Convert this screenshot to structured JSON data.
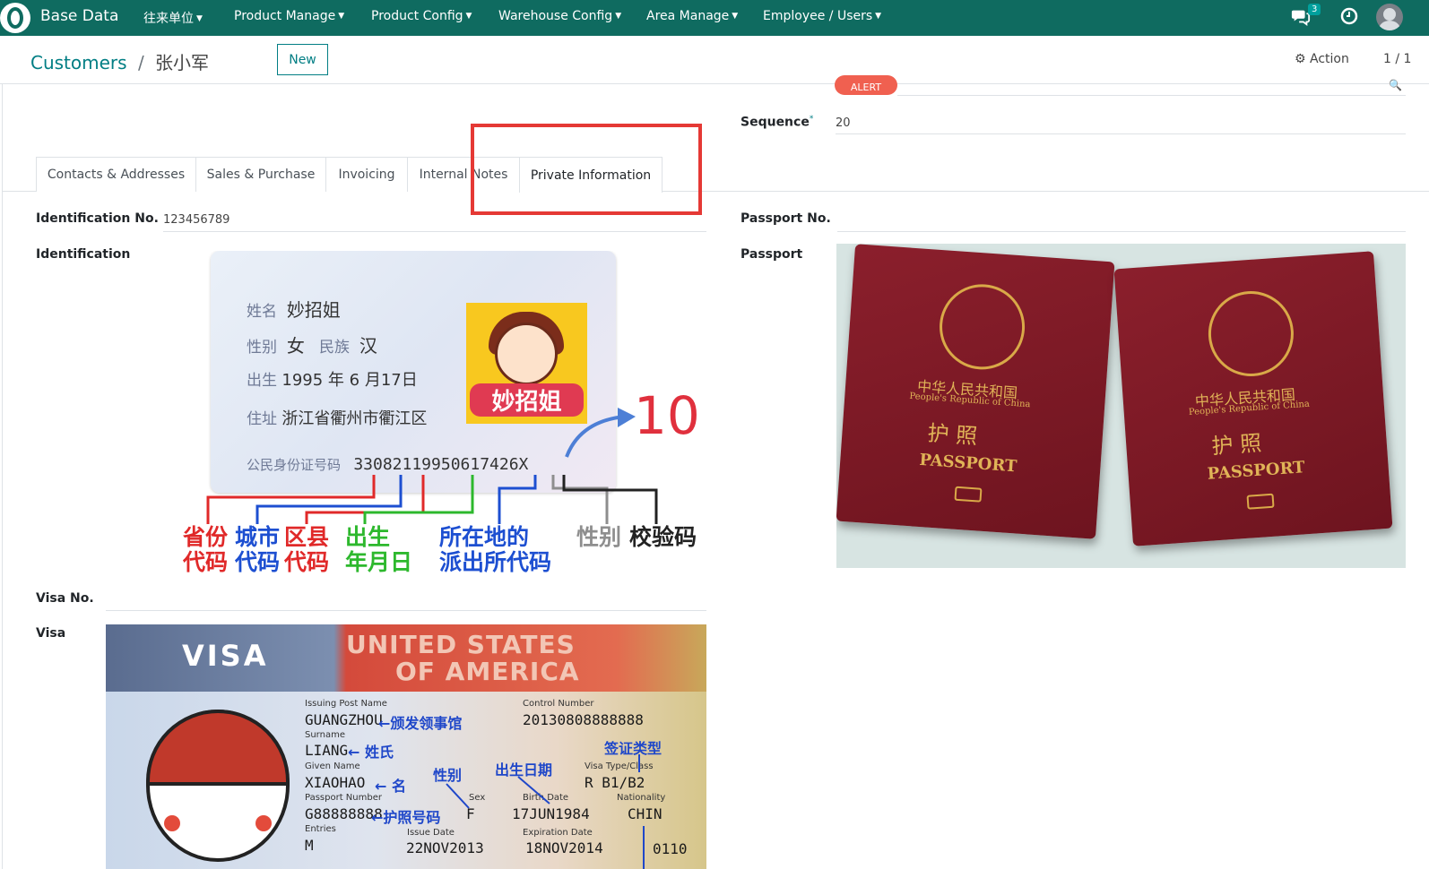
{
  "navbar": {
    "app_name": "Base Data",
    "menus": [
      "往来单位",
      "Product Manage",
      "Product Config",
      "Warehouse Config",
      "Area Manage",
      "Employee / Users"
    ],
    "chat_badge": "3",
    "icons": [
      "chat-icon",
      "clock-icon",
      "avatar"
    ]
  },
  "control": {
    "breadcrumb_parent": "Customers",
    "breadcrumb_sep": "/",
    "breadcrumb_current": "张小军",
    "new_label": "New",
    "action_label": "Action",
    "pager": "1 / 1"
  },
  "form": {
    "tag_label": "ALERT",
    "sequence_label": "Sequence",
    "sequence_required": "*",
    "sequence_value": "20",
    "tabs": [
      "Contacts & Addresses",
      "Sales & Purchase",
      "Invoicing",
      "Internal Notes",
      "Private Information"
    ],
    "active_tab": "Private Information",
    "identification_no_label": "Identification No.",
    "identification_no_value": "123456789",
    "identification_label": "Identification",
    "passport_no_label": "Passport No.",
    "passport_no_value": "",
    "passport_label": "Passport",
    "visa_no_label": "Visa No.",
    "visa_no_value": "",
    "visa_label": "Visa"
  },
  "id_card": {
    "name_label": "姓名",
    "name_value": "妙招姐",
    "sex_label": "性别",
    "sex_value": "女",
    "ethnic_label": "民族",
    "ethnic_value": "汉",
    "birth_label": "出生",
    "birth_value": "1995 年 6 月17日",
    "address_label": "住址",
    "address_value": "浙江省衢州市衢江区",
    "id_label": "公民身份证号码",
    "id_value": "33082119950617426X",
    "cartoon_text": "妙招姐",
    "digit_count": "10",
    "legend_1": "省份\n代码",
    "legend_2": "城市\n代码",
    "legend_3": "区县\n代码",
    "legend_4": "出生\n年月日",
    "legend_5": "所在地的\n派出所代码",
    "legend_6": "性别",
    "legend_7": "校验码"
  },
  "passport_img": {
    "cn_name": "中华人民共和国",
    "en_name": "People's Republic of China",
    "cn_title": "护  照",
    "en_title": "PASSPORT"
  },
  "visa_img": {
    "title": "VISA",
    "country_1": "UNITED STATES",
    "country_2": "OF AMERICA",
    "issuing_label": "Issuing Post Name",
    "issuing_value": "GUANGZHOU",
    "issuing_cn": "←颁发领事馆",
    "control_label": "Control Number",
    "control_value": "20130808888888",
    "surname_label": "Surname",
    "surname_value": "LIANG",
    "surname_cn": "← 姓氏",
    "given_label": "Given Name",
    "given_value": "XIAOHAO",
    "given_cn": "← 名",
    "visa_type_cn": "签证类型",
    "sex_cn": "性别",
    "birth_cn": "出生日期",
    "visa_type_label": "Visa Type/Class",
    "visa_type_value": "R    B1/B2",
    "passport_label": "Passport Number",
    "passport_value": "G88888888",
    "passport_cn": "←护照号码",
    "sex_label": "Sex",
    "sex_value": "F",
    "birth_label": "Birth Date",
    "birth_value": "17JUN1984",
    "nationality_label": "Nationality",
    "nationality_value": "CHIN",
    "entries_label": "Entries",
    "entries_value": "M",
    "issue_label": "Issue Date",
    "issue_value": "22NOV2013",
    "expiration_label": "Expiration Date",
    "expiration_value": "18NOV2014",
    "annotation_value": "0110"
  }
}
